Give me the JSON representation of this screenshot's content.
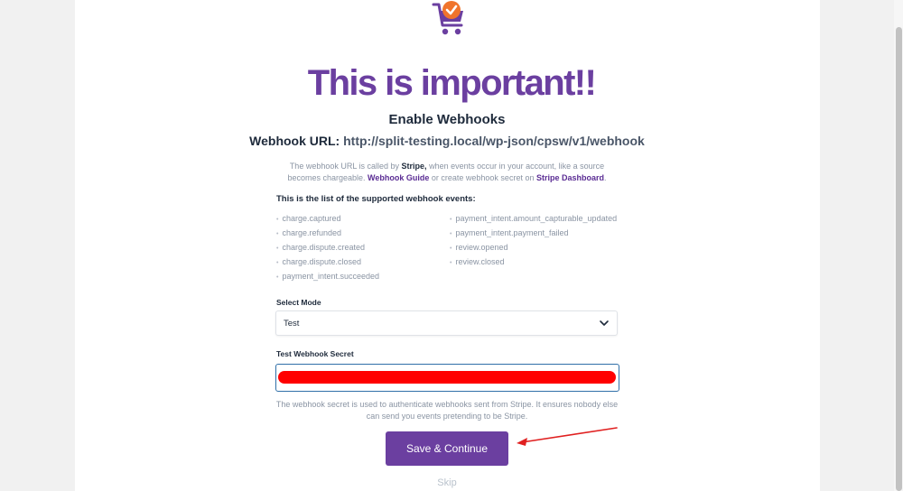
{
  "headline": "This is important!!",
  "subtitle": "Enable Webhooks",
  "webhook": {
    "label": "Webhook URL: ",
    "url": "http://split-testing.local/wp-json/cpsw/v1/webhook"
  },
  "description": {
    "part1": "The webhook URL is called by ",
    "stripe": "Stripe,",
    "part2": " when events occur in your account, like a source becomes chargeable. ",
    "guide_link": "Webhook Guide",
    "part3": " or create webhook secret on ",
    "dashboard_link": "Stripe Dashboard",
    "part4": "."
  },
  "events": {
    "heading": "This is the list of the supported webhook events:",
    "left": [
      "charge.captured",
      "charge.refunded",
      "charge.dispute.created",
      "charge.dispute.closed",
      "payment_intent.succeeded"
    ],
    "right": [
      "payment_intent.amount_capturable_updated",
      "payment_intent.payment_failed",
      "review.opened",
      "review.closed"
    ]
  },
  "mode": {
    "label": "Select Mode",
    "selected": "Test"
  },
  "secret": {
    "label": "Test Webhook Secret",
    "help": "The webhook secret is used to authenticate webhooks sent from Stripe. It ensures nobody else can send you events pretending to be Stripe."
  },
  "save_button": "Save & Continue",
  "skip": "Skip",
  "colors": {
    "brand_purple": "#6b3fa0",
    "logo_orange": "#f0742c",
    "redaction": "#ff0000",
    "annotation_arrow": "#e02020"
  }
}
